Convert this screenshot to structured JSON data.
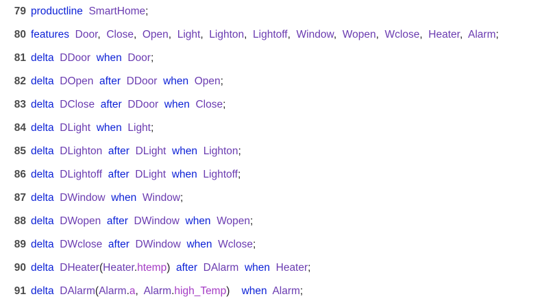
{
  "editor": {
    "lines": [
      {
        "number": "79",
        "tokens": [
          {
            "t": "productline",
            "k": "kw"
          },
          {
            "t": "  ",
            "k": "pn"
          },
          {
            "t": "SmartHome",
            "k": "id"
          },
          {
            "t": ";",
            "k": "pn"
          }
        ]
      },
      {
        "number": "80",
        "tokens": [
          {
            "t": "features",
            "k": "kw"
          },
          {
            "t": "  ",
            "k": "pn"
          },
          {
            "t": "Door",
            "k": "id"
          },
          {
            "t": ",  ",
            "k": "pn"
          },
          {
            "t": "Close",
            "k": "id"
          },
          {
            "t": ",  ",
            "k": "pn"
          },
          {
            "t": "Open",
            "k": "id"
          },
          {
            "t": ",  ",
            "k": "pn"
          },
          {
            "t": "Light",
            "k": "id"
          },
          {
            "t": ",  ",
            "k": "pn"
          },
          {
            "t": "Lighton",
            "k": "id"
          },
          {
            "t": ",  ",
            "k": "pn"
          },
          {
            "t": "Lightoff",
            "k": "id"
          },
          {
            "t": ",  ",
            "k": "pn"
          },
          {
            "t": "Window",
            "k": "id"
          },
          {
            "t": ",  ",
            "k": "pn"
          },
          {
            "t": "Wopen",
            "k": "id"
          },
          {
            "t": ",  ",
            "k": "pn"
          },
          {
            "t": "Wclose",
            "k": "id"
          },
          {
            "t": ",  ",
            "k": "pn"
          },
          {
            "t": "Heater",
            "k": "id"
          },
          {
            "t": ",  ",
            "k": "pn"
          },
          {
            "t": "Alarm",
            "k": "id"
          },
          {
            "t": ";",
            "k": "pn"
          }
        ]
      },
      {
        "number": "81",
        "tokens": [
          {
            "t": "delta",
            "k": "kw"
          },
          {
            "t": "  ",
            "k": "pn"
          },
          {
            "t": "DDoor",
            "k": "id"
          },
          {
            "t": "  ",
            "k": "pn"
          },
          {
            "t": "when",
            "k": "kw"
          },
          {
            "t": "  ",
            "k": "pn"
          },
          {
            "t": "Door",
            "k": "id"
          },
          {
            "t": ";",
            "k": "pn"
          }
        ]
      },
      {
        "number": "82",
        "tokens": [
          {
            "t": "delta",
            "k": "kw"
          },
          {
            "t": "  ",
            "k": "pn"
          },
          {
            "t": "DOpen",
            "k": "id"
          },
          {
            "t": "  ",
            "k": "pn"
          },
          {
            "t": "after",
            "k": "kw"
          },
          {
            "t": "  ",
            "k": "pn"
          },
          {
            "t": "DDoor",
            "k": "id"
          },
          {
            "t": "  ",
            "k": "pn"
          },
          {
            "t": "when",
            "k": "kw"
          },
          {
            "t": "  ",
            "k": "pn"
          },
          {
            "t": "Open",
            "k": "id"
          },
          {
            "t": ";",
            "k": "pn"
          }
        ]
      },
      {
        "number": "83",
        "tokens": [
          {
            "t": "delta",
            "k": "kw"
          },
          {
            "t": "  ",
            "k": "pn"
          },
          {
            "t": "DClose",
            "k": "id"
          },
          {
            "t": "  ",
            "k": "pn"
          },
          {
            "t": "after",
            "k": "kw"
          },
          {
            "t": "  ",
            "k": "pn"
          },
          {
            "t": "DDoor",
            "k": "id"
          },
          {
            "t": "  ",
            "k": "pn"
          },
          {
            "t": "when",
            "k": "kw"
          },
          {
            "t": "  ",
            "k": "pn"
          },
          {
            "t": "Close",
            "k": "id"
          },
          {
            "t": ";",
            "k": "pn"
          }
        ]
      },
      {
        "number": "84",
        "tokens": [
          {
            "t": "delta",
            "k": "kw"
          },
          {
            "t": "  ",
            "k": "pn"
          },
          {
            "t": "DLight",
            "k": "id"
          },
          {
            "t": "  ",
            "k": "pn"
          },
          {
            "t": "when",
            "k": "kw"
          },
          {
            "t": "  ",
            "k": "pn"
          },
          {
            "t": "Light",
            "k": "id"
          },
          {
            "t": ";",
            "k": "pn"
          }
        ]
      },
      {
        "number": "85",
        "tokens": [
          {
            "t": "delta",
            "k": "kw"
          },
          {
            "t": "  ",
            "k": "pn"
          },
          {
            "t": "DLighton",
            "k": "id"
          },
          {
            "t": "  ",
            "k": "pn"
          },
          {
            "t": "after",
            "k": "kw"
          },
          {
            "t": "  ",
            "k": "pn"
          },
          {
            "t": "DLight",
            "k": "id"
          },
          {
            "t": "  ",
            "k": "pn"
          },
          {
            "t": "when",
            "k": "kw"
          },
          {
            "t": "  ",
            "k": "pn"
          },
          {
            "t": "Lighton",
            "k": "id"
          },
          {
            "t": ";",
            "k": "pn"
          }
        ]
      },
      {
        "number": "86",
        "tokens": [
          {
            "t": "delta",
            "k": "kw"
          },
          {
            "t": "  ",
            "k": "pn"
          },
          {
            "t": "DLightoff",
            "k": "id"
          },
          {
            "t": "  ",
            "k": "pn"
          },
          {
            "t": "after",
            "k": "kw"
          },
          {
            "t": "  ",
            "k": "pn"
          },
          {
            "t": "DLight",
            "k": "id"
          },
          {
            "t": "  ",
            "k": "pn"
          },
          {
            "t": "when",
            "k": "kw"
          },
          {
            "t": "  ",
            "k": "pn"
          },
          {
            "t": "Lightoff",
            "k": "id"
          },
          {
            "t": ";",
            "k": "pn"
          }
        ]
      },
      {
        "number": "87",
        "tokens": [
          {
            "t": "delta",
            "k": "kw"
          },
          {
            "t": "  ",
            "k": "pn"
          },
          {
            "t": "DWindow",
            "k": "id"
          },
          {
            "t": "  ",
            "k": "pn"
          },
          {
            "t": "when",
            "k": "kw"
          },
          {
            "t": "  ",
            "k": "pn"
          },
          {
            "t": "Window",
            "k": "id"
          },
          {
            "t": ";",
            "k": "pn"
          }
        ]
      },
      {
        "number": "88",
        "tokens": [
          {
            "t": "delta",
            "k": "kw"
          },
          {
            "t": "  ",
            "k": "pn"
          },
          {
            "t": "DWopen",
            "k": "id"
          },
          {
            "t": "  ",
            "k": "pn"
          },
          {
            "t": "after",
            "k": "kw"
          },
          {
            "t": "  ",
            "k": "pn"
          },
          {
            "t": "DWindow",
            "k": "id"
          },
          {
            "t": "  ",
            "k": "pn"
          },
          {
            "t": "when",
            "k": "kw"
          },
          {
            "t": "  ",
            "k": "pn"
          },
          {
            "t": "Wopen",
            "k": "id"
          },
          {
            "t": ";",
            "k": "pn"
          }
        ]
      },
      {
        "number": "89",
        "tokens": [
          {
            "t": "delta",
            "k": "kw"
          },
          {
            "t": "  ",
            "k": "pn"
          },
          {
            "t": "DWclose",
            "k": "id"
          },
          {
            "t": "  ",
            "k": "pn"
          },
          {
            "t": "after",
            "k": "kw"
          },
          {
            "t": "  ",
            "k": "pn"
          },
          {
            "t": "DWindow",
            "k": "id"
          },
          {
            "t": "  ",
            "k": "pn"
          },
          {
            "t": "when",
            "k": "kw"
          },
          {
            "t": "  ",
            "k": "pn"
          },
          {
            "t": "Wclose",
            "k": "id"
          },
          {
            "t": ";",
            "k": "pn"
          }
        ]
      },
      {
        "number": "90",
        "tokens": [
          {
            "t": "delta",
            "k": "kw"
          },
          {
            "t": "  ",
            "k": "pn"
          },
          {
            "t": "DHeater",
            "k": "id"
          },
          {
            "t": "(",
            "k": "pn"
          },
          {
            "t": "Heater",
            "k": "id"
          },
          {
            "t": ".",
            "k": "pn"
          },
          {
            "t": "htemp",
            "k": "fld"
          },
          {
            "t": ")  ",
            "k": "pn"
          },
          {
            "t": "after",
            "k": "kw"
          },
          {
            "t": "  ",
            "k": "pn"
          },
          {
            "t": "DAlarm",
            "k": "id"
          },
          {
            "t": "  ",
            "k": "pn"
          },
          {
            "t": "when",
            "k": "kw"
          },
          {
            "t": "  ",
            "k": "pn"
          },
          {
            "t": "Heater",
            "k": "id"
          },
          {
            "t": ";",
            "k": "pn"
          }
        ]
      },
      {
        "number": "91",
        "tokens": [
          {
            "t": "delta",
            "k": "kw"
          },
          {
            "t": "  ",
            "k": "pn"
          },
          {
            "t": "DAlarm",
            "k": "id"
          },
          {
            "t": "(",
            "k": "pn"
          },
          {
            "t": "Alarm",
            "k": "id"
          },
          {
            "t": ".",
            "k": "pn"
          },
          {
            "t": "a",
            "k": "fld"
          },
          {
            "t": ",  ",
            "k": "pn"
          },
          {
            "t": "Alarm",
            "k": "id"
          },
          {
            "t": ".",
            "k": "pn"
          },
          {
            "t": "high_Temp",
            "k": "fld"
          },
          {
            "t": ")    ",
            "k": "pn"
          },
          {
            "t": "when",
            "k": "kw"
          },
          {
            "t": "  ",
            "k": "pn"
          },
          {
            "t": "Alarm",
            "k": "id"
          },
          {
            "t": ";",
            "k": "pn"
          }
        ]
      }
    ]
  },
  "colors": {
    "keyword": "#0a1fd6",
    "identifier": "#6a3bb0",
    "field": "#a43bc4",
    "line_number": "#4a4a4a",
    "background": "#ffffff"
  }
}
